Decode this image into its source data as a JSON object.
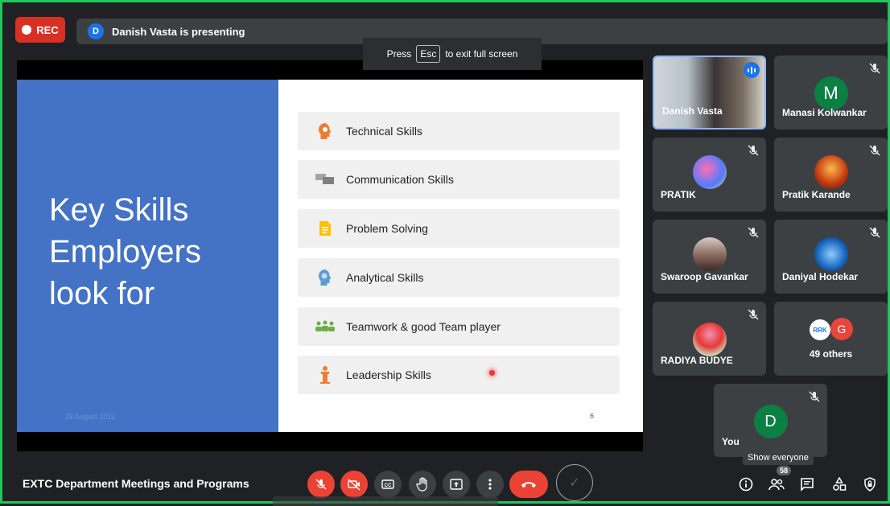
{
  "rec": {
    "label": "REC"
  },
  "presenting": {
    "avatar_initial": "D",
    "text": "Danish Vasta is presenting"
  },
  "esc_tip": {
    "before": "Press",
    "key": "Esc",
    "after": "to exit full screen"
  },
  "slide": {
    "title_lines": [
      "Key Skills",
      "Employers",
      "look for"
    ],
    "date": "28 August 2021",
    "page_number": "6",
    "skills": [
      {
        "label": "Technical Skills",
        "icon": "gear-head-icon",
        "color": "#ed7d31"
      },
      {
        "label": "Communication Skills",
        "icon": "speech-bubbles-icon",
        "color": "#a5a5a5"
      },
      {
        "label": "Problem Solving",
        "icon": "document-icon",
        "color": "#ffc000"
      },
      {
        "label": "Analytical Skills",
        "icon": "brain-head-icon",
        "color": "#5b9bd5"
      },
      {
        "label": "Teamwork & good Team player",
        "icon": "people-group-icon",
        "color": "#70ad47"
      },
      {
        "label": "Leadership Skills",
        "icon": "podium-person-icon",
        "color": "#ed7d31"
      }
    ]
  },
  "participants": [
    {
      "name": "Danish Vasta",
      "speaking": true
    },
    {
      "name": "Manasi Kolwankar",
      "initial": "M",
      "avatar_color": "#0b8043",
      "muted": true
    },
    {
      "name": "PRATIK",
      "muted": true
    },
    {
      "name": "Pratik Karande",
      "muted": true
    },
    {
      "name": "Swaroop Gavankar",
      "muted": true
    },
    {
      "name": "Daniyal Hodekar",
      "muted": true
    },
    {
      "name": "RADIYA BUDYE",
      "muted": true
    },
    {
      "name": "49 others",
      "badges": [
        "RRK",
        "G"
      ]
    },
    {
      "name": "You",
      "initial": "D",
      "avatar_color": "#0b8043",
      "muted": true
    }
  ],
  "bottom": {
    "meeting_title": "EXTC Department Meetings and Programs",
    "people_count": "58",
    "show_everyone_tooltip": "Show everyone"
  },
  "colors": {
    "accent": "#1a73e8",
    "danger": "#ea4335",
    "border": "#22c55e"
  }
}
